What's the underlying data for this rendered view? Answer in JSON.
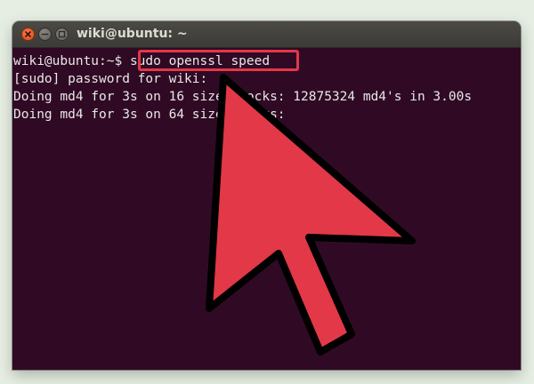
{
  "window": {
    "title": "wiki@ubuntu: ~",
    "buttons": {
      "close": "close-icon",
      "minimize": "minimize-icon",
      "maximize": "maximize-icon"
    }
  },
  "terminal": {
    "prompt": "wiki@ubuntu:~$ ",
    "command": "sudo openssl speed",
    "lines": [
      "[sudo] password for wiki:",
      "Doing md4 for 3s on 16 size blocks: 12875324 md4's in 3.00s",
      "Doing md4 for 3s on 64 size blocks:"
    ]
  },
  "annotation": {
    "arrow_icon": "pointer-arrow-icon",
    "color": "#e23848"
  },
  "colors": {
    "terminal_bg": "#300a24",
    "terminal_fg": "#e8e8e8",
    "page_bg": "#e6eee3"
  }
}
